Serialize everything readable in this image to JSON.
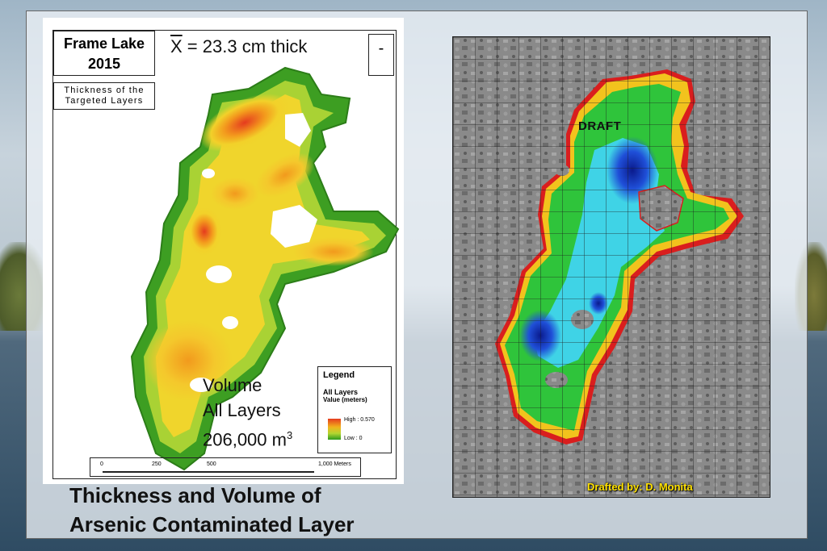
{
  "left_map": {
    "title_line1": "Frame Lake",
    "title_line2": "2015",
    "subtitle_line1": "Thickness of the",
    "subtitle_line2": "Targeted Layers",
    "mean_symbol": "X",
    "mean_text": " = 23.3 cm thick",
    "north_arrow": "-",
    "volume_line1": "Volume",
    "volume_line2": "All Layers",
    "volume_line3": "206,000 m",
    "volume_sup": "3",
    "legend": {
      "title": "Legend",
      "layer": "All Layers",
      "value_label": "Value (meters)",
      "high": "High : 0.570",
      "low": "Low : 0"
    },
    "scale": [
      "0",
      "250",
      "500",
      "1,000 Meters"
    ]
  },
  "right_map": {
    "draft_label": "DRAFT",
    "credit": "Drafted by: D. Monita"
  },
  "caption": {
    "line1": "Thickness and Volume of",
    "line2": "Arsenic Contaminated Layer"
  },
  "colors": {
    "thickness_high": "#e53b1e",
    "thickness_mid": "#f2b31c",
    "thickness_low": "#2d9a1e",
    "depth_deep": "#0a1a8c",
    "depth_mid": "#3fd3e6",
    "credit_yellow": "#ffe100"
  }
}
